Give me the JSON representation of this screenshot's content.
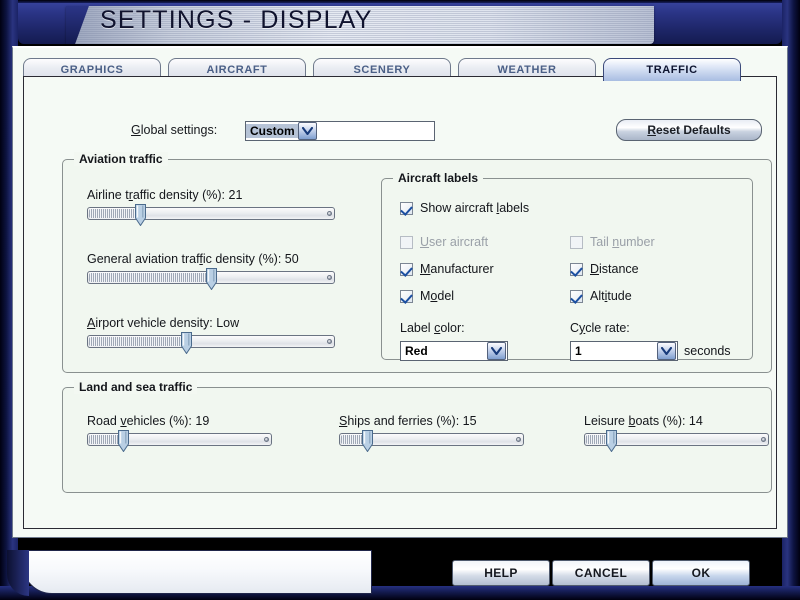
{
  "window": {
    "title": "SETTINGS - DISPLAY"
  },
  "tabs": [
    {
      "label": "GRAPHICS",
      "active": false
    },
    {
      "label": "AIRCRAFT",
      "active": false
    },
    {
      "label": "SCENERY",
      "active": false
    },
    {
      "label": "WEATHER",
      "active": false
    },
    {
      "label": "TRAFFIC",
      "active": true
    }
  ],
  "global": {
    "label": "Global settings:",
    "value": "Custom",
    "reset_label_prefix": "R",
    "reset_label_rest": "eset Defaults"
  },
  "aviation": {
    "title": "Aviation traffic",
    "sliders": [
      {
        "name": "airline-traffic-density",
        "label_pre": "Airline t",
        "label_key": "r",
        "label_post": "affic density (%): 21",
        "value": 21,
        "percent": 21
      },
      {
        "name": "general-aviation-traffic-density",
        "label_pre": "General aviation traf",
        "label_key": "f",
        "label_post": "ic density (%): 50",
        "value": 50,
        "percent": 50
      },
      {
        "name": "airport-vehicle-density",
        "label_pre": "",
        "label_key": "A",
        "label_post": "irport vehicle density: Low",
        "value": "Low",
        "percent": 40
      }
    ]
  },
  "labels_group": {
    "title": "Aircraft labels",
    "show": {
      "label_pre": "Show aircraft ",
      "label_key": "l",
      "label_post": "abels",
      "checked": true,
      "enabled": true
    },
    "items": [
      {
        "name": "user-aircraft",
        "label_pre": "",
        "label_key": "U",
        "label_post": "ser aircraft",
        "checked": false,
        "enabled": false
      },
      {
        "name": "tail-number",
        "label_pre": "Tail ",
        "label_key": "n",
        "label_post": "umber",
        "checked": false,
        "enabled": false
      },
      {
        "name": "manufacturer",
        "label_pre": "",
        "label_key": "M",
        "label_post": "anufacturer",
        "checked": true,
        "enabled": true
      },
      {
        "name": "distance",
        "label_pre": "",
        "label_key": "D",
        "label_post": "istance",
        "checked": true,
        "enabled": true
      },
      {
        "name": "model",
        "label_pre": "M",
        "label_key": "o",
        "label_post": "del",
        "checked": true,
        "enabled": true
      },
      {
        "name": "altitude",
        "label_pre": "Alt",
        "label_key": "i",
        "label_post": "tude",
        "checked": true,
        "enabled": true
      }
    ],
    "label_color": {
      "label_pre": "Label ",
      "label_key": "c",
      "label_post": "olor:",
      "value": "Red"
    },
    "cycle_rate": {
      "label_pre": "C",
      "label_key": "y",
      "label_post": "cle rate:",
      "value": "1",
      "units": "seconds"
    }
  },
  "land_sea": {
    "title": "Land and sea traffic",
    "sliders": [
      {
        "name": "road-vehicles",
        "label_pre": "Road ",
        "label_key": "v",
        "label_post": "ehicles (%): 19",
        "value": 19,
        "percent": 19
      },
      {
        "name": "ships-and-ferries",
        "label_pre": "",
        "label_key": "S",
        "label_post": "hips and ferries (%): 15",
        "value": 15,
        "percent": 15
      },
      {
        "name": "leisure-boats",
        "label_pre": "Leisure ",
        "label_key": "b",
        "label_post": "oats (%): 14",
        "value": 14,
        "percent": 14
      }
    ]
  },
  "footer": {
    "help": "HELP",
    "cancel": "CANCEL",
    "ok": "OK"
  },
  "colors": {
    "frame_navy": "#2b3587",
    "panel_bg": "#f5faf5",
    "group_bg": "#f1f7f0",
    "tab_active_text": "#0d1430",
    "tab_text": "#4a5f86",
    "check_blue": "#1b4fa0"
  }
}
